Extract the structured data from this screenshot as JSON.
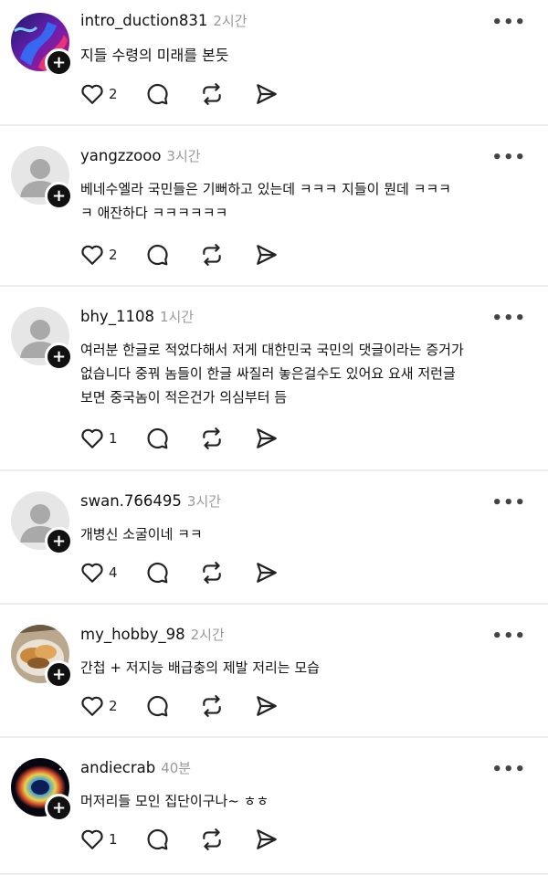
{
  "posts": [
    {
      "username": "intro_duction831",
      "time": "2시간",
      "text": "지들 수령의 미래를 본듯",
      "likes": "2",
      "avatar": "avatar-abstract"
    },
    {
      "username": "yangzzooo",
      "time": "3시간",
      "text": "베네수엘라 국민들은 기뻐하고 있는데 ㅋㅋㅋ 지들이 뭔데 ㅋㅋㅋ\nㅋ 애잔하다 ㅋㅋㅋㅋㅋㅋ",
      "likes": "2",
      "avatar": "avatar-default"
    },
    {
      "username": "bhy_1108",
      "time": "1시간",
      "text": "여러분 한글로 적었다해서 저게 대한민국 국민의 댓글이라는 증거가\n없습니다 중꿔 놈들이 한글 싸질러 놓은걸수도 있어요 요새 저런글\n보면 중국놈이 적은건가 의심부터 듬",
      "likes": "1",
      "avatar": "avatar-default"
    },
    {
      "username": "swan.766495",
      "time": "3시간",
      "text": "개병신 소굴이네 ㅋㅋ",
      "likes": "4",
      "avatar": "avatar-default"
    },
    {
      "username": "my_hobby_98",
      "time": "2시간",
      "text": "간첩 + 저지능 배급충의 제발 저리는 모습",
      "likes": "2",
      "avatar": "avatar-food"
    },
    {
      "username": "andiecrab",
      "time": "40분",
      "text": "머저리들 모인 집단이구나~ ㅎㅎ",
      "likes": "1",
      "avatar": "avatar-nebula"
    }
  ],
  "icons": {
    "more": "more-icon",
    "like": "heart-icon",
    "reply": "comment-icon",
    "repost": "repost-icon",
    "share": "send-icon",
    "follow": "plus-icon"
  },
  "colors": {
    "text": "#111111",
    "time": "#9a9a9a",
    "divider": "#ececec",
    "badge": "#111111"
  }
}
